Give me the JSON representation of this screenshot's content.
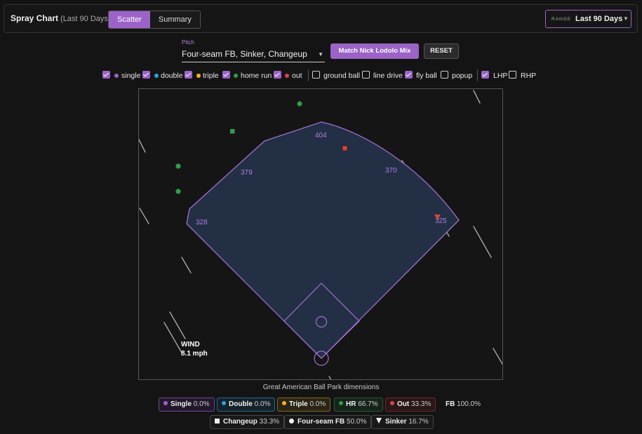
{
  "header": {
    "title": "Spray Chart",
    "subtitle": "(Last 90 Days)",
    "tabs": [
      {
        "label": "Scatter",
        "active": true
      },
      {
        "label": "Summary",
        "active": false
      }
    ],
    "range_label": "RANGE",
    "range_value": "Last 90 Days"
  },
  "controls": {
    "pitch_label": "Pitch",
    "pitch_value": "Four-seam FB, Sinker, Changeup",
    "match_button": "Match Nick Lodolo Mix",
    "reset_button": "RESET"
  },
  "filters": {
    "outcomes": [
      {
        "label": "single",
        "checked": true,
        "color": "#9b63c7"
      },
      {
        "label": "double",
        "checked": true,
        "color": "#29a3e0"
      },
      {
        "label": "triple",
        "checked": true,
        "color": "#f2b01e"
      },
      {
        "label": "home run",
        "checked": true,
        "color": "#2e9e48"
      },
      {
        "label": "out",
        "checked": true,
        "color": "#d64545"
      }
    ],
    "batted_ball": [
      {
        "label": "ground ball",
        "checked": false
      },
      {
        "label": "line drive",
        "checked": false
      },
      {
        "label": "fly ball",
        "checked": true
      },
      {
        "label": "popup",
        "checked": false
      }
    ],
    "handedness": [
      {
        "label": "LHP",
        "checked": true
      },
      {
        "label": "RHP",
        "checked": false
      }
    ]
  },
  "field": {
    "distances": {
      "lf": "328",
      "lcf": "379",
      "cf": "404",
      "rcf": "370",
      "rf": "325"
    },
    "wind_label": "WIND",
    "wind_speed": "8.1 mph",
    "caption": "Great American Ball Park dimensions",
    "colors": {
      "fair": "#232f45",
      "line": "#a070d0",
      "bg": "#151515"
    }
  },
  "summary": {
    "outcomes": [
      {
        "label": "Single",
        "pct": "0.0%",
        "color": "#9b63c7"
      },
      {
        "label": "Double",
        "pct": "0.0%",
        "color": "#29a3e0"
      },
      {
        "label": "Triple",
        "pct": "0.0%",
        "color": "#f2b01e"
      },
      {
        "label": "HR",
        "pct": "66.7%",
        "color": "#2e9e48"
      },
      {
        "label": "Out",
        "pct": "33.3%",
        "color": "#d64545"
      }
    ],
    "fb": {
      "label": "FB",
      "pct": "100.0%"
    },
    "pitches": [
      {
        "label": "Changeup",
        "pct": "33.3%",
        "icon": "square-icon"
      },
      {
        "label": "Four-seam FB",
        "pct": "50.0%",
        "icon": "circle-icon"
      },
      {
        "label": "Sinker",
        "pct": "16.7%",
        "icon": "triangle-icon"
      }
    ]
  }
}
